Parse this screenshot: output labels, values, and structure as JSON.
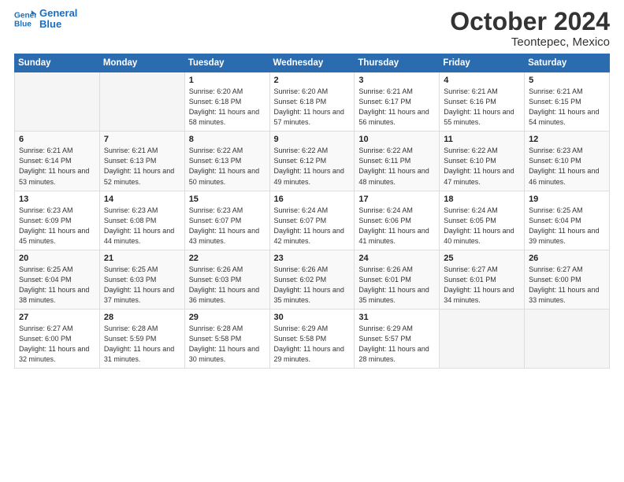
{
  "header": {
    "logo_line1": "General",
    "logo_line2": "Blue",
    "title": "October 2024",
    "subtitle": "Teontepec, Mexico"
  },
  "days_of_week": [
    "Sunday",
    "Monday",
    "Tuesday",
    "Wednesday",
    "Thursday",
    "Friday",
    "Saturday"
  ],
  "weeks": [
    [
      {
        "day": "",
        "sunrise": "",
        "sunset": "",
        "daylight": "",
        "empty": true
      },
      {
        "day": "",
        "sunrise": "",
        "sunset": "",
        "daylight": "",
        "empty": true
      },
      {
        "day": "1",
        "sunrise": "Sunrise: 6:20 AM",
        "sunset": "Sunset: 6:18 PM",
        "daylight": "Daylight: 11 hours and 58 minutes."
      },
      {
        "day": "2",
        "sunrise": "Sunrise: 6:20 AM",
        "sunset": "Sunset: 6:18 PM",
        "daylight": "Daylight: 11 hours and 57 minutes."
      },
      {
        "day": "3",
        "sunrise": "Sunrise: 6:21 AM",
        "sunset": "Sunset: 6:17 PM",
        "daylight": "Daylight: 11 hours and 56 minutes."
      },
      {
        "day": "4",
        "sunrise": "Sunrise: 6:21 AM",
        "sunset": "Sunset: 6:16 PM",
        "daylight": "Daylight: 11 hours and 55 minutes."
      },
      {
        "day": "5",
        "sunrise": "Sunrise: 6:21 AM",
        "sunset": "Sunset: 6:15 PM",
        "daylight": "Daylight: 11 hours and 54 minutes."
      }
    ],
    [
      {
        "day": "6",
        "sunrise": "Sunrise: 6:21 AM",
        "sunset": "Sunset: 6:14 PM",
        "daylight": "Daylight: 11 hours and 53 minutes."
      },
      {
        "day": "7",
        "sunrise": "Sunrise: 6:21 AM",
        "sunset": "Sunset: 6:13 PM",
        "daylight": "Daylight: 11 hours and 52 minutes."
      },
      {
        "day": "8",
        "sunrise": "Sunrise: 6:22 AM",
        "sunset": "Sunset: 6:13 PM",
        "daylight": "Daylight: 11 hours and 50 minutes."
      },
      {
        "day": "9",
        "sunrise": "Sunrise: 6:22 AM",
        "sunset": "Sunset: 6:12 PM",
        "daylight": "Daylight: 11 hours and 49 minutes."
      },
      {
        "day": "10",
        "sunrise": "Sunrise: 6:22 AM",
        "sunset": "Sunset: 6:11 PM",
        "daylight": "Daylight: 11 hours and 48 minutes."
      },
      {
        "day": "11",
        "sunrise": "Sunrise: 6:22 AM",
        "sunset": "Sunset: 6:10 PM",
        "daylight": "Daylight: 11 hours and 47 minutes."
      },
      {
        "day": "12",
        "sunrise": "Sunrise: 6:23 AM",
        "sunset": "Sunset: 6:10 PM",
        "daylight": "Daylight: 11 hours and 46 minutes."
      }
    ],
    [
      {
        "day": "13",
        "sunrise": "Sunrise: 6:23 AM",
        "sunset": "Sunset: 6:09 PM",
        "daylight": "Daylight: 11 hours and 45 minutes."
      },
      {
        "day": "14",
        "sunrise": "Sunrise: 6:23 AM",
        "sunset": "Sunset: 6:08 PM",
        "daylight": "Daylight: 11 hours and 44 minutes."
      },
      {
        "day": "15",
        "sunrise": "Sunrise: 6:23 AM",
        "sunset": "Sunset: 6:07 PM",
        "daylight": "Daylight: 11 hours and 43 minutes."
      },
      {
        "day": "16",
        "sunrise": "Sunrise: 6:24 AM",
        "sunset": "Sunset: 6:07 PM",
        "daylight": "Daylight: 11 hours and 42 minutes."
      },
      {
        "day": "17",
        "sunrise": "Sunrise: 6:24 AM",
        "sunset": "Sunset: 6:06 PM",
        "daylight": "Daylight: 11 hours and 41 minutes."
      },
      {
        "day": "18",
        "sunrise": "Sunrise: 6:24 AM",
        "sunset": "Sunset: 6:05 PM",
        "daylight": "Daylight: 11 hours and 40 minutes."
      },
      {
        "day": "19",
        "sunrise": "Sunrise: 6:25 AM",
        "sunset": "Sunset: 6:04 PM",
        "daylight": "Daylight: 11 hours and 39 minutes."
      }
    ],
    [
      {
        "day": "20",
        "sunrise": "Sunrise: 6:25 AM",
        "sunset": "Sunset: 6:04 PM",
        "daylight": "Daylight: 11 hours and 38 minutes."
      },
      {
        "day": "21",
        "sunrise": "Sunrise: 6:25 AM",
        "sunset": "Sunset: 6:03 PM",
        "daylight": "Daylight: 11 hours and 37 minutes."
      },
      {
        "day": "22",
        "sunrise": "Sunrise: 6:26 AM",
        "sunset": "Sunset: 6:03 PM",
        "daylight": "Daylight: 11 hours and 36 minutes."
      },
      {
        "day": "23",
        "sunrise": "Sunrise: 6:26 AM",
        "sunset": "Sunset: 6:02 PM",
        "daylight": "Daylight: 11 hours and 35 minutes."
      },
      {
        "day": "24",
        "sunrise": "Sunrise: 6:26 AM",
        "sunset": "Sunset: 6:01 PM",
        "daylight": "Daylight: 11 hours and 35 minutes."
      },
      {
        "day": "25",
        "sunrise": "Sunrise: 6:27 AM",
        "sunset": "Sunset: 6:01 PM",
        "daylight": "Daylight: 11 hours and 34 minutes."
      },
      {
        "day": "26",
        "sunrise": "Sunrise: 6:27 AM",
        "sunset": "Sunset: 6:00 PM",
        "daylight": "Daylight: 11 hours and 33 minutes."
      }
    ],
    [
      {
        "day": "27",
        "sunrise": "Sunrise: 6:27 AM",
        "sunset": "Sunset: 6:00 PM",
        "daylight": "Daylight: 11 hours and 32 minutes."
      },
      {
        "day": "28",
        "sunrise": "Sunrise: 6:28 AM",
        "sunset": "Sunset: 5:59 PM",
        "daylight": "Daylight: 11 hours and 31 minutes."
      },
      {
        "day": "29",
        "sunrise": "Sunrise: 6:28 AM",
        "sunset": "Sunset: 5:58 PM",
        "daylight": "Daylight: 11 hours and 30 minutes."
      },
      {
        "day": "30",
        "sunrise": "Sunrise: 6:29 AM",
        "sunset": "Sunset: 5:58 PM",
        "daylight": "Daylight: 11 hours and 29 minutes."
      },
      {
        "day": "31",
        "sunrise": "Sunrise: 6:29 AM",
        "sunset": "Sunset: 5:57 PM",
        "daylight": "Daylight: 11 hours and 28 minutes."
      },
      {
        "day": "",
        "sunrise": "",
        "sunset": "",
        "daylight": "",
        "empty": true
      },
      {
        "day": "",
        "sunrise": "",
        "sunset": "",
        "daylight": "",
        "empty": true
      }
    ]
  ]
}
